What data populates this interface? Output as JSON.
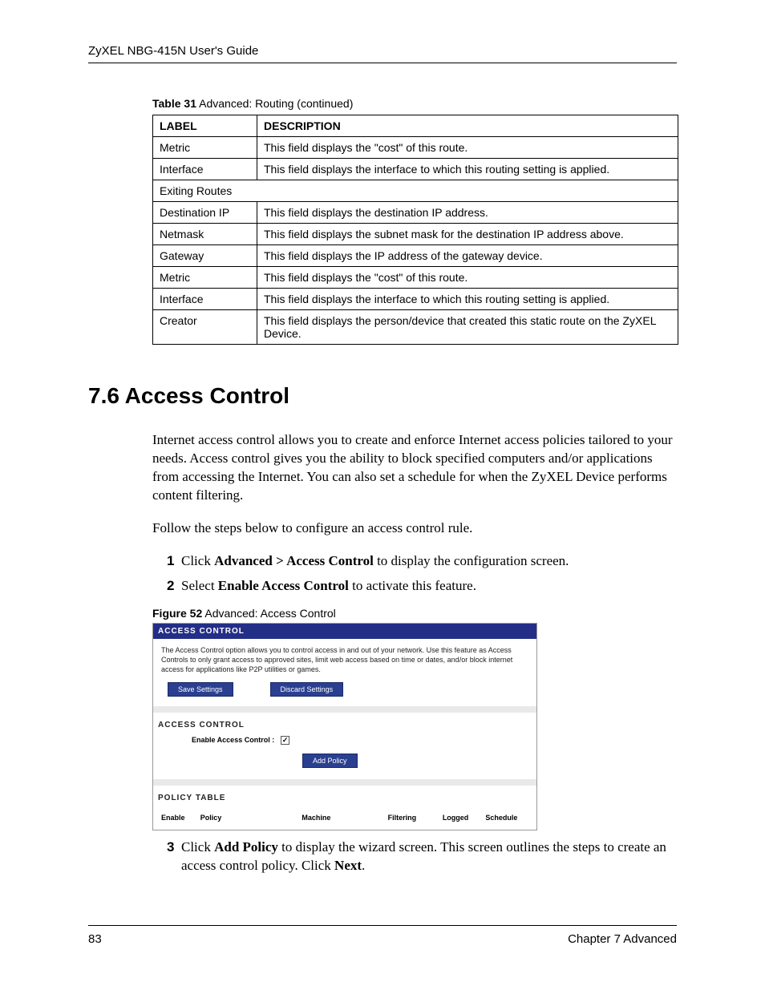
{
  "header": {
    "title": "ZyXEL NBG-415N User's Guide"
  },
  "table": {
    "caption_label": "Table 31",
    "caption_text": "   Advanced: Routing (continued)",
    "head_label": "LABEL",
    "head_desc": "DESCRIPTION",
    "rows": [
      {
        "label": "Metric",
        "desc": "This field displays the \"cost\" of this route."
      },
      {
        "label": "Interface",
        "desc": "This field displays the interface to which this routing setting is applied."
      },
      {
        "label": "Exiting Routes",
        "desc": "",
        "span": true
      },
      {
        "label": "Destination IP",
        "desc": "This field displays the destination IP address."
      },
      {
        "label": "Netmask",
        "desc": "This field displays the subnet mask for the destination IP address above."
      },
      {
        "label": "Gateway",
        "desc": "This field displays the IP address of the gateway device."
      },
      {
        "label": "Metric",
        "desc": "This field displays the \"cost\" of this route."
      },
      {
        "label": "Interface",
        "desc": "This field displays the interface to which this routing setting is applied."
      },
      {
        "label": "Creator",
        "desc": "This field displays the person/device that created this static route on the ZyXEL Device."
      }
    ]
  },
  "section": {
    "heading": "7.6  Access Control",
    "para1": "Internet access control allows you to create and enforce Internet access policies tailored to your needs. Access control gives you the ability to block specified computers and/or applications from accessing the Internet. You can also set a schedule for when the ZyXEL Device performs content filtering.",
    "para2": "Follow the steps below to configure an access control rule."
  },
  "steps": {
    "s1_num": "1",
    "s1_a": "Click ",
    "s1_bold": "Advanced > Access Control",
    "s1_b": " to display the configuration screen.",
    "s2_num": "2",
    "s2_a": "Select ",
    "s2_bold": "Enable Access Control",
    "s2_b": " to activate this feature.",
    "s3_num": "3",
    "s3_a": "Click ",
    "s3_bold1": "Add Policy",
    "s3_b": " to display the wizard screen. This screen outlines the steps to create an access control policy. Click ",
    "s3_bold2": "Next",
    "s3_c": "."
  },
  "figure": {
    "caption_label": "Figure 52",
    "caption_text": "   Advanced: Access Control",
    "title1": "ACCESS CONTROL",
    "desc": "The Access Control option allows you to control access in and out of your network. Use this feature as Access Controls to only grant access to approved sites, limit web access based on time or dates, and/or block internet access for applications like P2P utilities or games.",
    "btn_save": "Save Settings",
    "btn_discard": "Discard Settings",
    "title2": "ACCESS CONTROL",
    "enable_label": "Enable Access Control :",
    "checkbox_mark": "✓",
    "btn_add": "Add Policy",
    "title3": "POLICY TABLE",
    "cols": [
      "Enable",
      "Policy",
      "Machine",
      "Filtering",
      "Logged",
      "Schedule"
    ]
  },
  "footer": {
    "page": "83",
    "chapter": "Chapter 7 Advanced"
  }
}
